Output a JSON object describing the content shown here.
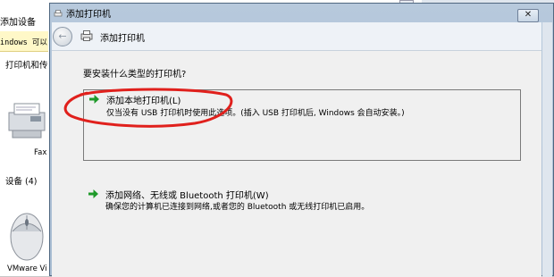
{
  "background_window": {
    "title": "添加设备",
    "info_text": "indows 可以",
    "section_printers": "打印机和传",
    "fax_label": "Fax",
    "section_devices": "设备 (4)",
    "vmware_label": "VMware Vi"
  },
  "dialog": {
    "title": "添加打印机",
    "close_glyph": "✕",
    "nav": {
      "back_glyph": "←",
      "title": "添加打印机"
    },
    "question": "要安装什么类型的打印机?",
    "options": [
      {
        "title": "添加本地打印机(L)",
        "description": "仅当没有 USB 打印机时使用此选项。(插入 USB 打印机后, Windows 会自动安装。)"
      },
      {
        "title": "添加网络、无线或 Bluetooth 打印机(W)",
        "description": "确保您的计算机已连接到网络,或者您的 Bluetooth 或无线打印机已启用。"
      }
    ]
  },
  "colors": {
    "arrow_green": "#1f9a2a",
    "highlight_red": "#e0201c",
    "dialog_frame": "#a9bdd3",
    "content_bg": "#f0f0f0"
  },
  "icons": [
    "printer-icon",
    "back-arrow-icon",
    "green-arrow-icon",
    "fax-icon",
    "mouse-icon"
  ]
}
